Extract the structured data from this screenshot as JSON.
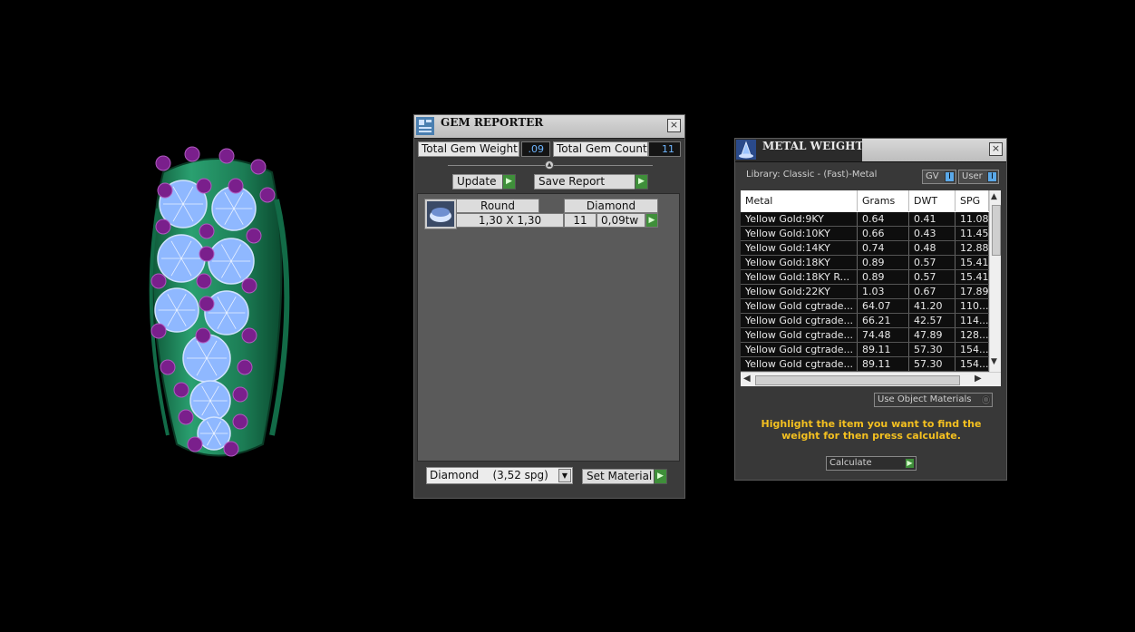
{
  "gem_reporter": {
    "title": "GEM REPORTER",
    "total_weight_label": "Total Gem Weight",
    "total_weight_value": ".09",
    "total_count_label": "Total Gem Count",
    "total_count_value": "11",
    "update_label": "Update",
    "save_report_label": "Save Report",
    "row": {
      "shape": "Round",
      "material": "Diamond",
      "size": "1,30 X 1,30",
      "count": "11",
      "weight": "0,09tw"
    },
    "material_select": "Diamond    (3,52 spg)",
    "set_material_label": "Set Material"
  },
  "metal_weights": {
    "title": "METAL WEIGHTS",
    "library": "Library: Classic - (Fast)-Metal",
    "toggle_gv": "GV",
    "toggle_user": "User",
    "columns": [
      "Metal",
      "Grams",
      "DWT",
      "SPG"
    ],
    "rows": [
      [
        "Yellow Gold:9KY",
        "0.64",
        "0.41",
        "11.08"
      ],
      [
        "Yellow Gold:10KY",
        "0.66",
        "0.43",
        "11.45"
      ],
      [
        "Yellow Gold:14KY",
        "0.74",
        "0.48",
        "12.88"
      ],
      [
        "Yellow Gold:18KY",
        "0.89",
        "0.57",
        "15.41"
      ],
      [
        "Yellow Gold:18KY R...",
        "0.89",
        "0.57",
        "15.41"
      ],
      [
        "Yellow Gold:22KY",
        "1.03",
        "0.67",
        "17.89"
      ],
      [
        "Yellow Gold cgtrade...",
        "64.07",
        "41.20",
        "110..."
      ],
      [
        "Yellow Gold cgtrade...",
        "66.21",
        "42.57",
        "114..."
      ],
      [
        "Yellow Gold cgtrade...",
        "74.48",
        "47.89",
        "128..."
      ],
      [
        "Yellow Gold cgtrade...",
        "89.11",
        "57.30",
        "154..."
      ],
      [
        "Yellow Gold cgtrade...",
        "89.11",
        "57.30",
        "154..."
      ]
    ],
    "use_object_materials": "Use Object Materials",
    "hint": "Highlight the item you want to find the weight for then press calculate.",
    "calculate_label": "Calculate"
  },
  "colors": {
    "ring_metal": "#1f8a5c",
    "gem_blue": "#8fb8ff",
    "prong_purple": "#7a1f8c",
    "hint_yellow": "#f4c020",
    "go_green": "#3f8f3a"
  }
}
